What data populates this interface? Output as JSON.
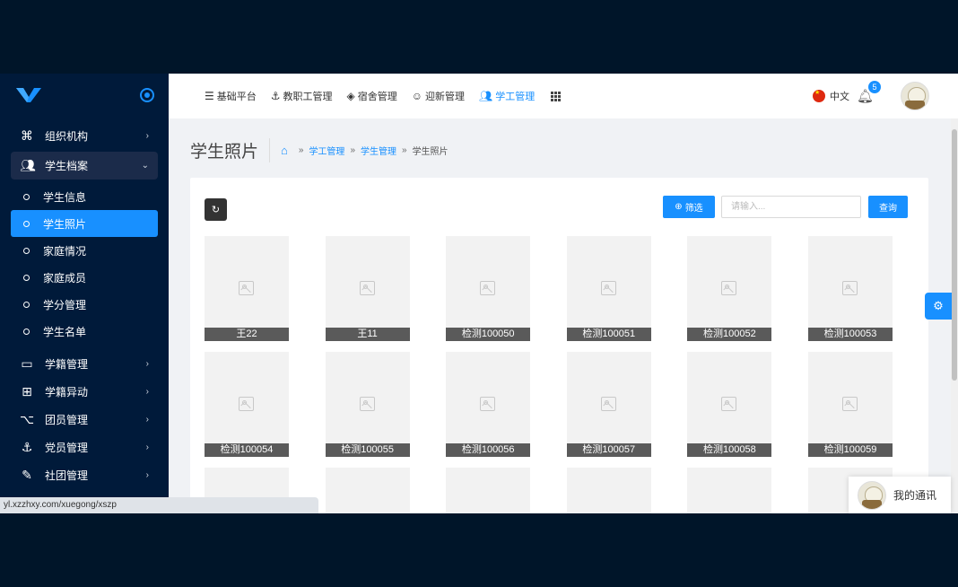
{
  "sidebar": {
    "items": [
      {
        "label": "组织机构",
        "icon": "command-icon",
        "has_arrow": true
      },
      {
        "label": "学生档案",
        "icon": "users-icon",
        "open": true
      },
      {
        "label": "学籍管理",
        "icon": "card-icon"
      },
      {
        "label": "学籍异动",
        "icon": "folder-plus-icon"
      },
      {
        "label": "团员管理",
        "icon": "git-icon"
      },
      {
        "label": "党员管理",
        "icon": "anchor-icon"
      },
      {
        "label": "社团管理",
        "icon": "feather-icon"
      }
    ],
    "sub_items": [
      "学生信息",
      "学生照片",
      "家庭情况",
      "家庭成员",
      "学分管理",
      "学生名单"
    ],
    "active_sub": "学生照片"
  },
  "header": {
    "nav": [
      {
        "label": "基础平台",
        "icon": "database-icon"
      },
      {
        "label": "教职工管理",
        "icon": "anchor-icon"
      },
      {
        "label": "宿舍管理",
        "icon": "layers-icon"
      },
      {
        "label": "迎新管理",
        "icon": "smile-icon"
      },
      {
        "label": "学工管理",
        "icon": "users-icon",
        "active": true
      }
    ],
    "language": "中文",
    "notification_count": "5"
  },
  "page": {
    "title": "学生照片",
    "breadcrumb": [
      "学工管理",
      "学工管理",
      "学生照片"
    ],
    "breadcrumb_links": [
      "学工管理",
      "学生管理"
    ],
    "breadcrumb_current": "学生照片"
  },
  "toolbar": {
    "filter_label": "筛选",
    "search_placeholder": "请输入...",
    "query_label": "查询"
  },
  "photos": [
    "王22",
    "王11",
    "检测100050",
    "检测100051",
    "检测100052",
    "检测100053",
    "检测100054",
    "检测100055",
    "检测100056",
    "检测100057",
    "检测100058",
    "检测100059"
  ],
  "chat": {
    "label": "我的通讯"
  },
  "status_url": "yl.xzzhxy.com/xuegong/xszp",
  "colors": {
    "accent": "#1890ff",
    "sidebar_bg": "#001a3a",
    "page_bg": "#f0f2f5"
  }
}
